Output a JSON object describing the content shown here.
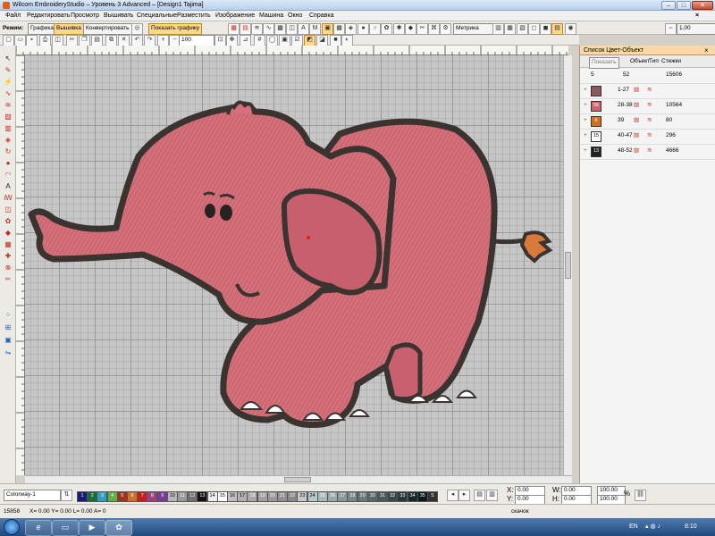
{
  "window": {
    "title": "Wilcom EmbroideryStudio – Уровень 3 Advanced – [Design1     Tajima]"
  },
  "menu": [
    "Файл",
    "Редактировать",
    "Просмотр",
    "Вышивать",
    "Специальные",
    "Разместить",
    "Изображение",
    "Машина",
    "Окно",
    "Справка"
  ],
  "toolbar": {
    "mode_label": "Режим:",
    "graphics": "Графика",
    "embroidery": "Вышивка",
    "convert": "Конвертировать",
    "show_graphics": "Показать графику",
    "zoom": "100",
    "units": "Метрика",
    "size_value": "1.00"
  },
  "panel": {
    "title": "Список Цвет-Объект",
    "show_btn": "Показать",
    "col_object": "Объект",
    "col_type": "Тип",
    "col_stitches": "Стежки",
    "summary": {
      "count": "5",
      "objects": "52",
      "stitches": "15606"
    },
    "rows": [
      {
        "swatch": "",
        "swatch_color": "#8a5a5a",
        "range": "1-27",
        "stitches": ""
      },
      {
        "swatch": "56",
        "swatch_color": "#d0606a",
        "range": "28-38",
        "stitches": "10564"
      },
      {
        "swatch": "6",
        "swatch_color": "#d07020",
        "range": "39",
        "stitches": "80"
      },
      {
        "swatch": "15",
        "swatch_color": "#ffffff",
        "range": "40-47",
        "stitches": "296"
      },
      {
        "swatch": "13",
        "swatch_color": "#222222",
        "range": "48-52",
        "stitches": "4666"
      }
    ]
  },
  "colorway": {
    "name": "Colorway-1",
    "swatches": [
      {
        "n": "1",
        "c": "#1a1a7a"
      },
      {
        "n": "2",
        "c": "#1a6a3a"
      },
      {
        "n": "3",
        "c": "#30a0c0"
      },
      {
        "n": "4",
        "c": "#60b040"
      },
      {
        "n": "5",
        "c": "#a03020"
      },
      {
        "n": "6",
        "c": "#d07020"
      },
      {
        "n": "7",
        "c": "#c02020"
      },
      {
        "n": "8",
        "c": "#a04080"
      },
      {
        "n": "9",
        "c": "#7a3a9a"
      },
      {
        "n": "10",
        "c": "#b8b8b8"
      },
      {
        "n": "11",
        "c": "#9a9a9a"
      },
      {
        "n": "12",
        "c": "#707070"
      },
      {
        "n": "13",
        "c": "#101010"
      },
      {
        "n": "14",
        "c": "#f0f0f0"
      },
      {
        "n": "15",
        "c": "#ffffff"
      },
      {
        "n": "16",
        "c": "#c0c0c0"
      },
      {
        "n": "17",
        "c": "#b0b0b0"
      },
      {
        "n": "18",
        "c": "#a8a8a8"
      },
      {
        "n": "19",
        "c": "#a0a0a0"
      },
      {
        "n": "20",
        "c": "#989898"
      },
      {
        "n": "21",
        "c": "#909090"
      },
      {
        "n": "22",
        "c": "#888888"
      },
      {
        "n": "23",
        "c": "#c8c8c8"
      },
      {
        "n": "24",
        "c": "#b8c8c8"
      },
      {
        "n": "25",
        "c": "#a8b8b8"
      },
      {
        "n": "26",
        "c": "#98a8a8"
      },
      {
        "n": "27",
        "c": "#889898"
      },
      {
        "n": "28",
        "c": "#788888"
      },
      {
        "n": "29",
        "c": "#687878"
      },
      {
        "n": "30",
        "c": "#586868"
      },
      {
        "n": "31",
        "c": "#485858"
      },
      {
        "n": "32",
        "c": "#384848"
      },
      {
        "n": "33",
        "c": "#283838"
      },
      {
        "n": "34",
        "c": "#182828"
      },
      {
        "n": "35",
        "c": "#081818"
      },
      {
        "n": "S",
        "c": "#303030"
      }
    ]
  },
  "transform": {
    "x_label": "X:",
    "x": "0.00",
    "y_label": "Y:",
    "y": "0.00",
    "w_label": "W:",
    "w": "0.00",
    "h_label": "H:",
    "h": "0.00",
    "sx": "100.00",
    "sy": "100.00",
    "pct": "%"
  },
  "status": {
    "stitches": "15858",
    "coords": "X=  0.00 Y=  0.00 L=  0.00 A=  0",
    "action": "скачок"
  },
  "taskbar": {
    "lang": "EN",
    "time": "8:10"
  }
}
